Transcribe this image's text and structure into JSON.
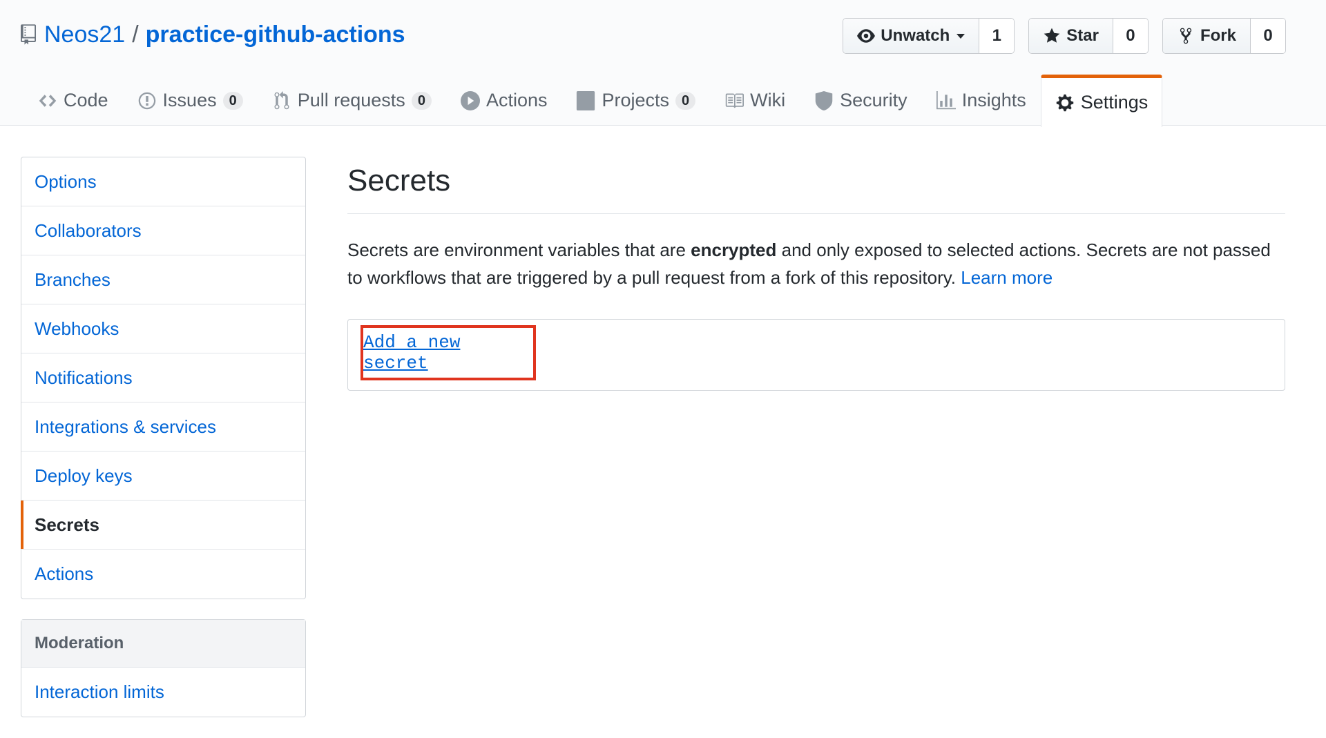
{
  "repo": {
    "owner": "Neos21",
    "separator": "/",
    "name": "practice-github-actions"
  },
  "actions": {
    "watch_label": "Unwatch",
    "watch_count": "1",
    "star_label": "Star",
    "star_count": "0",
    "fork_label": "Fork",
    "fork_count": "0"
  },
  "nav": {
    "code": "Code",
    "issues": "Issues",
    "issues_count": "0",
    "pulls": "Pull requests",
    "pulls_count": "0",
    "actions": "Actions",
    "projects": "Projects",
    "projects_count": "0",
    "wiki": "Wiki",
    "security": "Security",
    "insights": "Insights",
    "settings": "Settings"
  },
  "sidebar": {
    "items": [
      {
        "label": "Options"
      },
      {
        "label": "Collaborators"
      },
      {
        "label": "Branches"
      },
      {
        "label": "Webhooks"
      },
      {
        "label": "Notifications"
      },
      {
        "label": "Integrations & services"
      },
      {
        "label": "Deploy keys"
      },
      {
        "label": "Secrets"
      },
      {
        "label": "Actions"
      }
    ],
    "selected": "Secrets",
    "moderation_heading": "Moderation",
    "moderation_items": [
      {
        "label": "Interaction limits"
      }
    ]
  },
  "main": {
    "title": "Secrets",
    "desc_part1": "Secrets are environment variables that are ",
    "desc_bold": "encrypted",
    "desc_part2": " and only exposed to selected actions. Secrets are not passed to workflows that are triggered by a pull request from a fork of this repository. ",
    "learn_more": "Learn more",
    "add_secret": "Add a new secret"
  },
  "colors": {
    "link": "#0366d6",
    "accent": "#e36209",
    "highlight_box": "#e0341e"
  }
}
